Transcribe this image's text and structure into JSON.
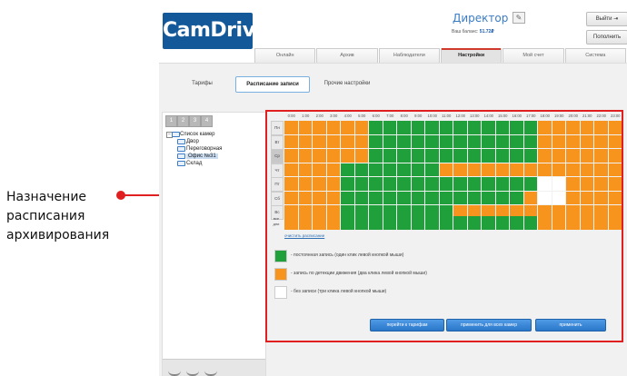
{
  "annotation": {
    "lines": [
      "Назначение",
      "расписания",
      "архивирования"
    ],
    "color": "#e02020"
  },
  "header": {
    "logo": "CamDrive",
    "user": "Директор",
    "balance_label": "Ваш баланс:",
    "balance_value": "51.72₽",
    "exit_label": "Выйти",
    "topup_label": "Пополнить"
  },
  "tabs": [
    "Онлайн",
    "Архив",
    "Наблюдатели",
    "Настройки",
    "Мой счет",
    "Система"
  ],
  "active_tab": 3,
  "subtabs": [
    "Тарифы",
    "Расписание записи",
    "Прочие настройки"
  ],
  "active_subtab": 1,
  "camera_numbers": [
    "1",
    "2",
    "3",
    "4"
  ],
  "tree": {
    "root": "Список камер",
    "cameras": [
      "Двор",
      "Переговорная",
      "Офис №31",
      "Склад"
    ],
    "selected": 2
  },
  "schedule": {
    "hours": [
      "0:00",
      "1:00",
      "2:00",
      "3:00",
      "4:00",
      "5:00",
      "6:00",
      "7:00",
      "8:00",
      "9:00",
      "10:00",
      "11:00",
      "12:00",
      "13:00",
      "14:00",
      "15:00",
      "16:00",
      "17:00",
      "18:00",
      "19:00",
      "20:00",
      "21:00",
      "22:00",
      "23:00"
    ],
    "days": [
      "Пн",
      "Вт",
      "Ср",
      "Чт",
      "Пт",
      "Сб",
      "Вс"
    ],
    "selected_day": 2,
    "all_label": "все дни",
    "clear_label": "очистить расписание",
    "colors": {
      "continuous": "#1fa03a",
      "motion": "#f7941d",
      "none": "#ffffff"
    },
    "grid": [
      [
        "m",
        "m",
        "m",
        "m",
        "m",
        "m",
        "c",
        "c",
        "c",
        "c",
        "c",
        "c",
        "c",
        "c",
        "c",
        "c",
        "c",
        "c",
        "m",
        "m",
        "m",
        "m",
        "m",
        "m"
      ],
      [
        "m",
        "m",
        "m",
        "m",
        "m",
        "m",
        "c",
        "c",
        "c",
        "c",
        "c",
        "c",
        "c",
        "c",
        "c",
        "c",
        "c",
        "c",
        "m",
        "m",
        "m",
        "m",
        "m",
        "m"
      ],
      [
        "m",
        "m",
        "m",
        "m",
        "m",
        "m",
        "c",
        "c",
        "c",
        "c",
        "c",
        "c",
        "c",
        "c",
        "c",
        "c",
        "c",
        "c",
        "m",
        "m",
        "m",
        "m",
        "m",
        "m"
      ],
      [
        "m",
        "m",
        "m",
        "m",
        "c",
        "c",
        "c",
        "c",
        "c",
        "c",
        "c",
        "m",
        "m",
        "m",
        "m",
        "m",
        "m",
        "m",
        "m",
        "m",
        "m",
        "m",
        "m",
        "m"
      ],
      [
        "m",
        "m",
        "m",
        "m",
        "c",
        "c",
        "c",
        "c",
        "c",
        "c",
        "c",
        "c",
        "c",
        "c",
        "c",
        "c",
        "c",
        "c",
        "n",
        "n",
        "m",
        "m",
        "m",
        "m"
      ],
      [
        "m",
        "m",
        "m",
        "m",
        "c",
        "c",
        "c",
        "c",
        "c",
        "c",
        "c",
        "c",
        "c",
        "c",
        "c",
        "c",
        "c",
        "m",
        "n",
        "n",
        "m",
        "m",
        "m",
        "m"
      ],
      [
        "m",
        "m",
        "m",
        "m",
        "c",
        "c",
        "c",
        "c",
        "c",
        "c",
        "c",
        "c",
        "m",
        "m",
        "m",
        "m",
        "m",
        "m",
        "m",
        "m",
        "m",
        "m",
        "m",
        "m"
      ]
    ],
    "all_row": [
      "m",
      "m",
      "m",
      "m",
      "c",
      "c",
      "c",
      "c",
      "c",
      "c",
      "c",
      "c",
      "c",
      "c",
      "c",
      "c",
      "c",
      "c",
      "m",
      "m",
      "m",
      "m",
      "m",
      "m"
    ]
  },
  "legend": [
    {
      "key": "continuous",
      "text": "- постоянная запись (один клик левой кнопкой мыши)"
    },
    {
      "key": "motion",
      "text": "- запись по детекции движения (два клика левой кнопкой мыши)"
    },
    {
      "key": "none",
      "text": "- без записи (три клика левой кнопкой мыши)"
    }
  ],
  "actions": [
    "перейти к тарифам",
    "применить для всех камер",
    "применить"
  ]
}
